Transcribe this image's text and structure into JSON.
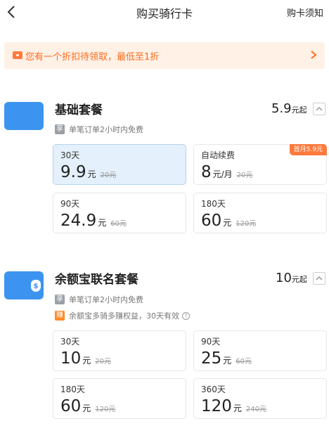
{
  "header": {
    "title": "购买骑行卡",
    "help": "购卡须知"
  },
  "discount": {
    "text": "您有一个折扣待领取，最低至1折"
  },
  "packages": [
    {
      "title": "基础套餐",
      "price": "5.9",
      "price_suffix": "元起",
      "benefits": [
        {
          "badge": "享",
          "text": "单笔订单2小时内免费"
        }
      ],
      "options": [
        {
          "duration": "30天",
          "price": "9.9",
          "unit": "元",
          "original": "20元",
          "selected": true
        },
        {
          "duration": "自动续费",
          "price": "8",
          "unit": "元/月",
          "original": "20元",
          "tag": "首月5.9元"
        },
        {
          "duration": "90天",
          "price": "24.9",
          "unit": "元",
          "original": "60元"
        },
        {
          "duration": "180天",
          "price": "60",
          "unit": "元",
          "original": "120元"
        }
      ]
    },
    {
      "title": "余额宝联名套餐",
      "icon_char": "$",
      "price": "10",
      "price_suffix": "元起",
      "benefits": [
        {
          "badge": "享",
          "text": "单笔订单2小时内免费"
        },
        {
          "badge": "赚",
          "text": "余额宝多骑多赚权益，30天有效",
          "help": "?"
        }
      ],
      "options": [
        {
          "duration": "30天",
          "price": "10",
          "unit": "元",
          "original": "20元"
        },
        {
          "duration": "90天",
          "price": "25",
          "unit": "元",
          "original": "60元"
        },
        {
          "duration": "180天",
          "price": "60",
          "unit": "元",
          "original": "120元"
        },
        {
          "duration": "360天",
          "price": "120",
          "unit": "元",
          "original": "240元"
        }
      ]
    }
  ],
  "colors": {
    "accent": "#3c94f0",
    "discount_text": "#ff6a1a",
    "discount_bg": "#fff1e6",
    "selected_card": "#e4f0fb"
  }
}
